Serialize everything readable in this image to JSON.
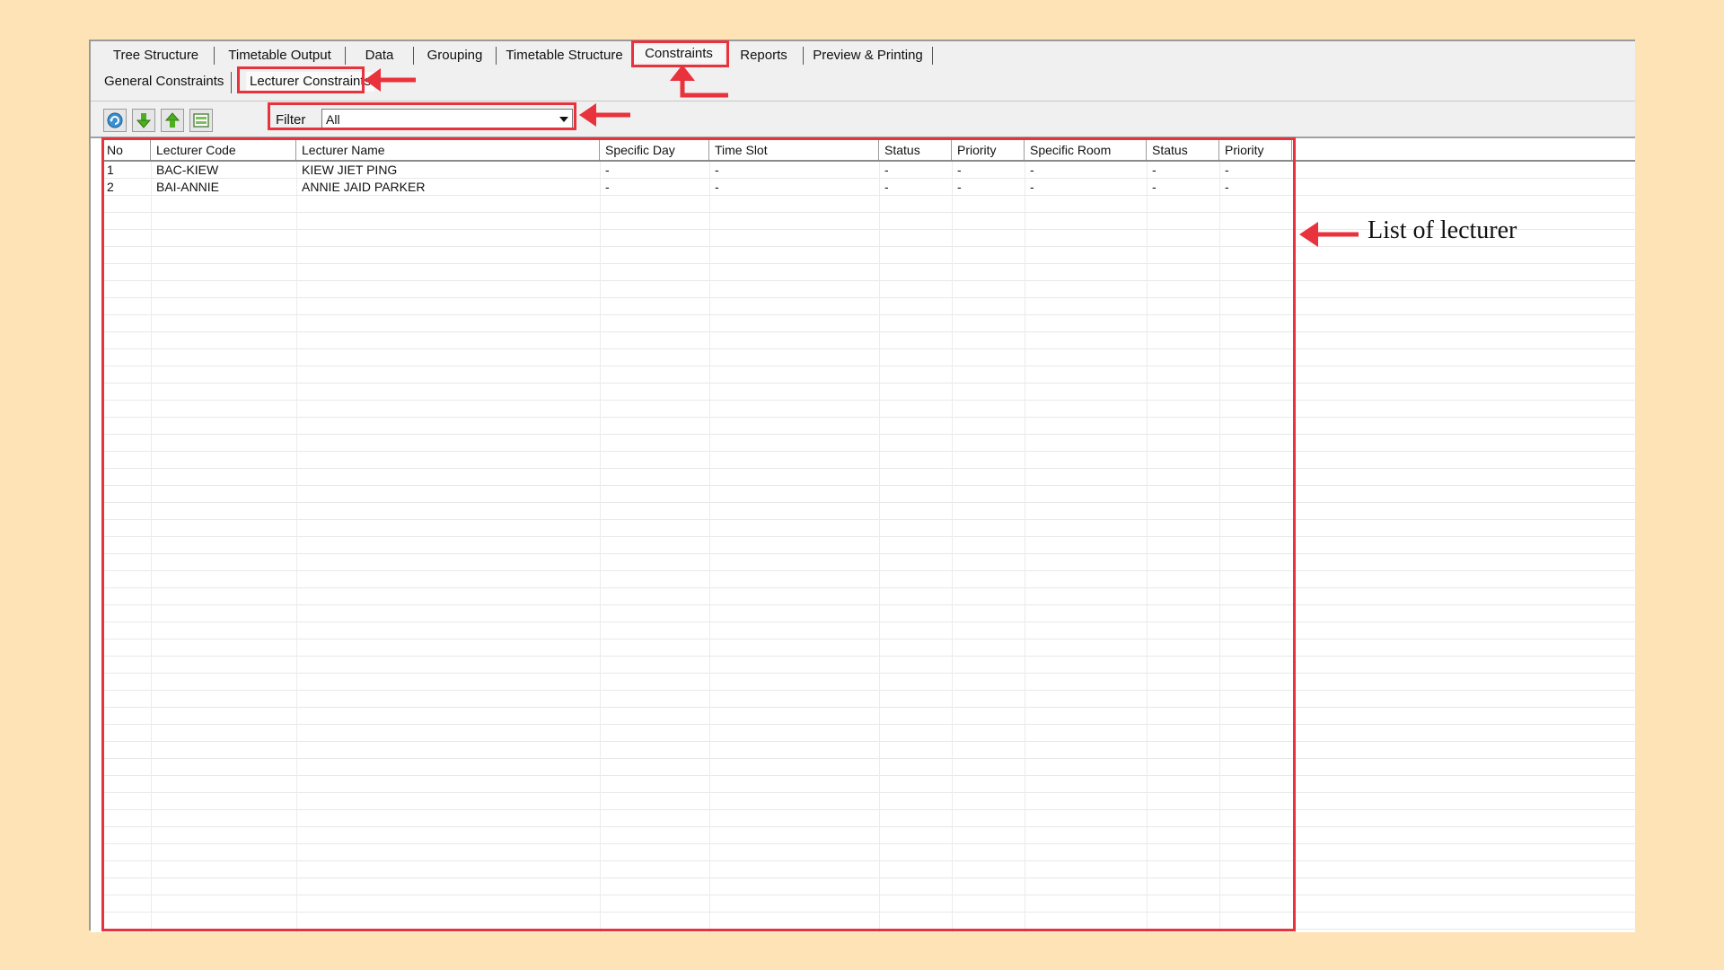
{
  "main_tabs": [
    "Tree Structure",
    "Timetable Output",
    "Data",
    "Grouping",
    "Timetable Structure",
    "Constraints",
    "Reports",
    "Preview & Printing"
  ],
  "sub_tabs": [
    "General Constraints",
    "Lecturer Constraints"
  ],
  "toolbar": {
    "icons": [
      "refresh-icon",
      "download-icon",
      "upload-icon",
      "save-icon"
    ],
    "filter_label": "Filter",
    "filter_value": "All"
  },
  "table": {
    "columns": [
      "No",
      "Lecturer Code",
      "Lecturer Name",
      "Specific Day",
      "Time Slot",
      "Status",
      "Priority",
      "Specific Room",
      "Status",
      "Priority"
    ],
    "rows": [
      [
        "1",
        "BAC-KIEW",
        "KIEW JIET PING",
        "-",
        "-",
        "-",
        "-",
        "-",
        "-",
        "-"
      ],
      [
        "2",
        "BAI-ANNIE",
        "ANNIE JAID PARKER",
        "-",
        "-",
        "-",
        "-",
        "-",
        "-",
        "-"
      ]
    ]
  },
  "annotation": {
    "label": "List of lecturer",
    "color": "#e8323c"
  }
}
